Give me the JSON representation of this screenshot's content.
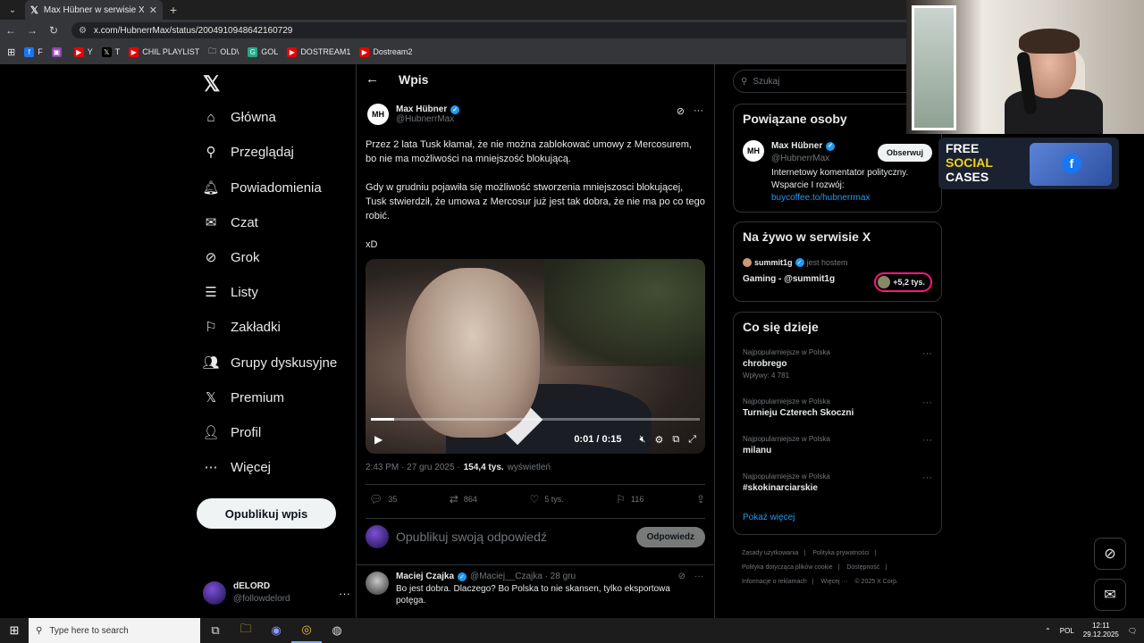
{
  "browser": {
    "tab_title": "Max Hübner w serwisie X: „Prze",
    "url": "x.com/HubnerrMax/status/2004910948642160729",
    "bookmarks": [
      "F",
      "",
      "Y",
      "T",
      "CHIL PLAYLIST",
      "OLD\\",
      "GOL",
      "DOSTREAM1",
      "Dostream2"
    ]
  },
  "nav": {
    "items": [
      "Główna",
      "Przeglądaj",
      "Powiadomienia",
      "Czat",
      "Grok",
      "Listy",
      "Zakładki",
      "Grupy dyskusyjne",
      "Premium",
      "Profil",
      "Więcej"
    ],
    "post_button": "Opublikuj wpis",
    "me_name": "dELORD",
    "me_handle": "@followdelord"
  },
  "main": {
    "header": "Wpis",
    "author_name": "Max Hübner",
    "author_handle": "@HubnerrMax",
    "avatar_text": "MH",
    "text1": "Przez 2 lata Tusk kłamał, że nie można zablokować umowy z Mercosurem, bo nie ma możliwości na mniejszość blokującą.",
    "text2": "Gdy w grudniu pojawiła się możliwość stworzenia mniejszosci blokującej, Tusk stwierdził, że umowa z Mercosur już jest tak dobra, że nie ma po co tego robić.",
    "text3": "xD",
    "video_time": "0:01 / 0:15",
    "video_progress": 0.07,
    "timestamp": "2:43 PM · 27 gru 2025 ·",
    "views": "154,4 tys.",
    "views_label": "wyświetleń",
    "replies": "35",
    "reposts": "864",
    "likes": "5 tys.",
    "bookmarks": "116",
    "reply_placeholder": "Opublikuj swoją odpowiedź",
    "reply_button": "Odpowiedz",
    "comment": {
      "name": "Maciej Czajka",
      "handle": "@Maciej__Czajka · 28 gru",
      "text": "Bo jest dobra. Dlaczego? Bo Polska to nie skansen, tylko eksportowa potęga."
    }
  },
  "right": {
    "search_placeholder": "Szukaj",
    "related_title": "Powiązane osoby",
    "related_name": "Max Hübner",
    "related_handle": "@HubnerrMax",
    "related_bio": "Internetowy komentator polityczny. Wsparcie I rozwój:",
    "related_link": "buycoffee.to/hubnerrmax",
    "follow_button": "Obserwuj",
    "live_title": "Na żywo w serwisie X",
    "live_host": "summit1g",
    "live_host_label": "jest hostem",
    "live_name": "Gaming - @summit1g",
    "live_count": "+5,2 tys.",
    "trends_title": "Co się dzieje",
    "trends": [
      {
        "category": "Najpopularniejsze w Polska",
        "title": "chrobrego",
        "posts": "Wpływy: 4 781"
      },
      {
        "category": "Najpopularniejsze w Polska",
        "title": "Turnieju Czterech Skoczni",
        "posts": ""
      },
      {
        "category": "Najpopularniejsze w Polska",
        "title": "milanu",
        "posts": ""
      },
      {
        "category": "Najpopularniejsze w Polska",
        "title": "#skokinarciarskie",
        "posts": ""
      }
    ],
    "show_more": "Pokaż więcej",
    "footer": [
      "Zasady użytkowania",
      "|",
      "Polityka prywatności",
      "|",
      "Polityka dotycząca plików cookie",
      "|",
      "Dostępność",
      "|",
      "Informacje o reklamach",
      "|",
      "Więcej ···",
      "© 2025 X Corp."
    ]
  },
  "promo": {
    "line1": "FREE",
    "line2": "SOCIAL",
    "line3": "CASES"
  },
  "taskbar": {
    "search_placeholder": "Type here to search",
    "lang": "POL",
    "time": "12:11",
    "date": "29.12.2025"
  }
}
